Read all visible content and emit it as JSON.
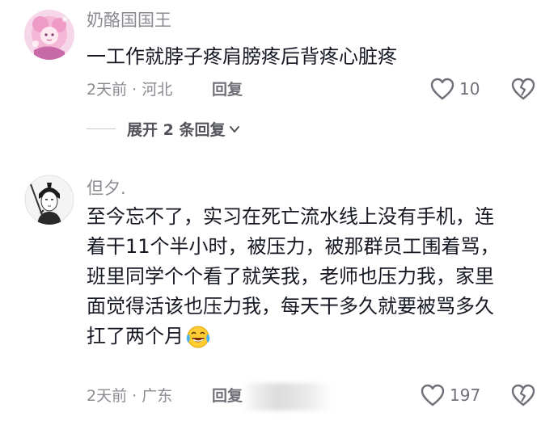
{
  "comments": [
    {
      "author": "奶酪国国王",
      "text_lines": [
        "一工作就脖子疼肩膀疼后背疼心脏疼"
      ],
      "meta": "2天前 · 河北",
      "reply_label": "回复",
      "like_count": "10",
      "expand_label": "展开 2 条回复"
    },
    {
      "author": "但夕.",
      "text_lines": [
        "至今忘不了，实习在死亡流水线上没有手机，连",
        "着干11个半小时，被压力，被那群员工围着骂，",
        "班里同学个个看了就笑我，老师也压力我，家里",
        "面觉得活该也压力我，每天干多久就要被骂多久",
        "扛了两个月"
      ],
      "meta": "2天前 · 广东",
      "reply_label": "回复",
      "like_count": "197"
    }
  ],
  "colors": {
    "text": "#161823",
    "secondary": "#8a8b91",
    "reply": "#6f7078",
    "icon": "#6f7078"
  }
}
